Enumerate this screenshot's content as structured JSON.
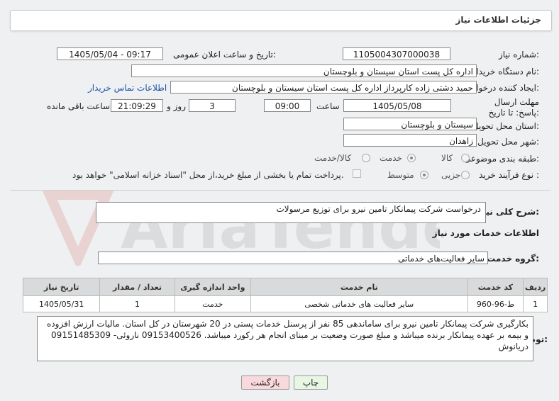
{
  "header": {
    "title": "جزئیات اطلاعات نیاز"
  },
  "fields": {
    "need_number": {
      "label": "شماره نیاز:",
      "value": "1105004307000038"
    },
    "announce_datetime": {
      "label": "تاریخ و ساعت اعلان عمومی:",
      "value": "1405/05/04 - 09:17"
    },
    "buyer_org": {
      "label": "نام دستگاه خریدار:",
      "value": "اداره کل پست استان سیستان و بلوچستان"
    },
    "creator": {
      "label": "ایجاد کننده درخواست:",
      "value": "حمید دشتی زاده کارپرداز اداره کل پست استان سیستان و بلوچستان",
      "contact_link": "اطلاعات تماس خریدار"
    },
    "deadline": {
      "label": "مهلت ارسال پاسخ: تا تاریخ:",
      "date": "1405/05/08",
      "time_label": "ساعت",
      "time": "09:00",
      "days": "3",
      "days_label": "روز و",
      "remaining": "21:09:29",
      "remaining_label": "ساعت باقی مانده"
    },
    "province": {
      "label": "استان محل تحویل:",
      "value": "سیستان و بلوچستان"
    },
    "city": {
      "label": "شهر محل تحویل:",
      "value": "زاهدان"
    },
    "category": {
      "label": "طبقه بندی موضوعی:",
      "options": [
        "کالا",
        "خدمت",
        "کالا/خدمت"
      ],
      "selected": "خدمت"
    },
    "process": {
      "label": "نوع فرآیند خرید :",
      "options": [
        "جزیی",
        "متوسط"
      ],
      "selected": "متوسط",
      "payment_note": "پرداخت تمام یا بخشی از مبلغ خرید،از محل \"اسناد خزانه اسلامی\" خواهد بود."
    }
  },
  "summary": {
    "label": "شرح کلی نیاز:",
    "value": "درخواست شرکت پیمانکار تامین نیرو برای توزیع مرسولات"
  },
  "services_info": {
    "title": "اطلاعات خدمات مورد نیاز",
    "group_label": "گروه خدمت:",
    "group_value": "سایر فعالیت‌های خدماتی"
  },
  "table": {
    "headers": [
      "ردیف",
      "کد خدمت",
      "نام خدمت",
      "واحد اندازه گیری",
      "تعداد / مقدار",
      "تاریخ نیاز"
    ],
    "rows": [
      [
        "1",
        "ط-96-960",
        "سایر فعالیت های خدماتی شخصی",
        "خدمت",
        "1",
        "1405/05/31"
      ]
    ]
  },
  "buyer_notes": {
    "label": "توضیحات خریدار:",
    "text": "بکارگیری شرکت پیمانکار تامین نیرو برای ساماندهی 85 نفر از پرسنل خدمات پستی در 20 شهرستان در کل استان. مالیات ارزش افزوده و بیمه بر عهده پیمانکار برنده میباشد و مبلغ صورت وضعیت بر مبنای انجام هر رکورد میباشد. 09153400526 ناروئی- 09151485309 دریانوش"
  },
  "buttons": {
    "print": "چاپ",
    "back": "بازگشت"
  },
  "watermark": {
    "text": "AriaTender.neT"
  },
  "colors": {
    "link": "#2255aa",
    "back_button_bg": "#f9d9dc",
    "print_button_bg": "#e8f6e4"
  }
}
